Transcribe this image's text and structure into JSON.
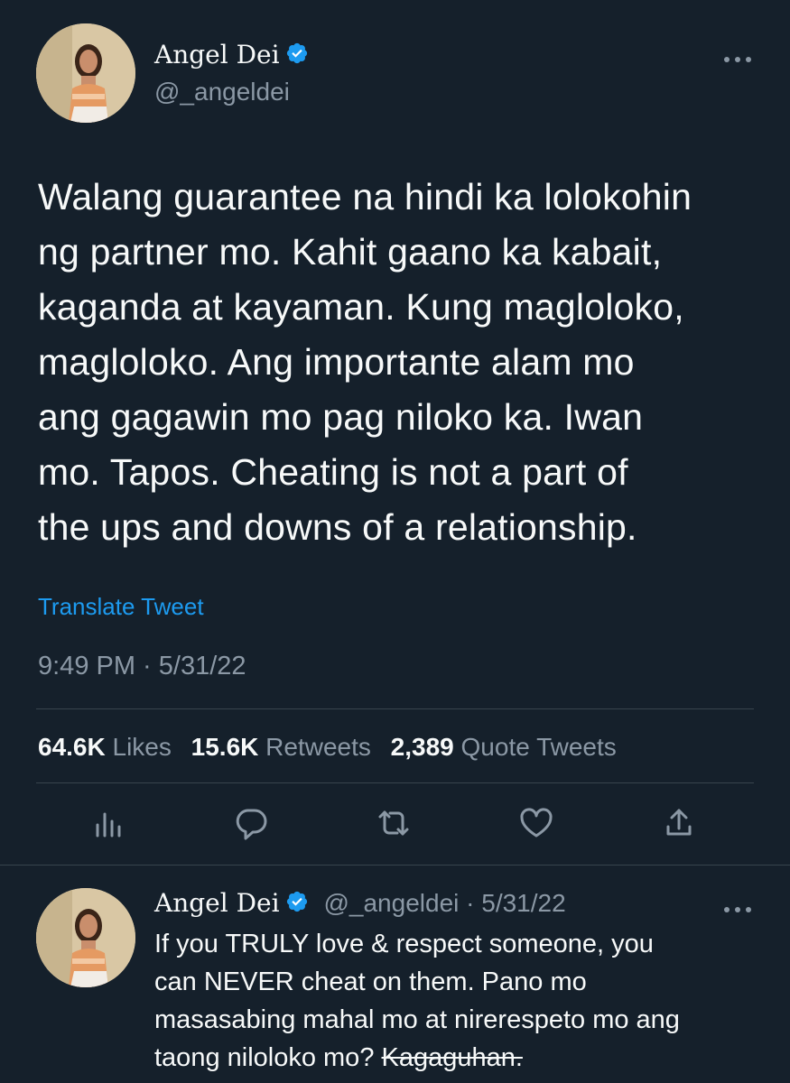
{
  "main_tweet": {
    "author_name": "Angel Dei",
    "author_handle": "@_angeldei",
    "more_icon": "more-horizontal-icon",
    "text": "Walang guarantee na hindi ka lolokohin\nng partner mo. Kahit gaano ka kabait,\nkaganda at kayaman. Kung magloloko,\nmagloloko. Ang importante alam mo\nang gagawin mo pag niloko ka. Iwan\nmo. Tapos. Cheating is not a part of\nthe ups and downs of a relationship.",
    "translate_label": "Translate Tweet",
    "timestamp": "9:49 PM · 5/31/22",
    "stats": {
      "likes_count": "64.6K",
      "likes_label": "Likes",
      "retweets_count": "15.6K",
      "retweets_label": "Retweets",
      "quotes_count": "2,389",
      "quotes_label": "Quote Tweets"
    },
    "actions": [
      "analytics-icon",
      "reply-icon",
      "retweet-icon",
      "like-icon",
      "share-icon"
    ]
  },
  "reply_tweet": {
    "author_name": "Angel Dei",
    "author_handle": "@_angeldei",
    "date": "5/31/22",
    "separator": "·",
    "text_main": "If you TRULY love & respect someone, you\ncan NEVER cheat on them. Pano mo\nmasasabing mahal mo at nirerespeto mo ang\ntaong niloloko mo? ",
    "text_struck": "Kagaguhan."
  },
  "colors": {
    "background": "#15202b",
    "text_primary": "#f7f9f9",
    "text_secondary": "#8b98a5",
    "accent": "#1d9bf0",
    "divider": "#38444d"
  }
}
